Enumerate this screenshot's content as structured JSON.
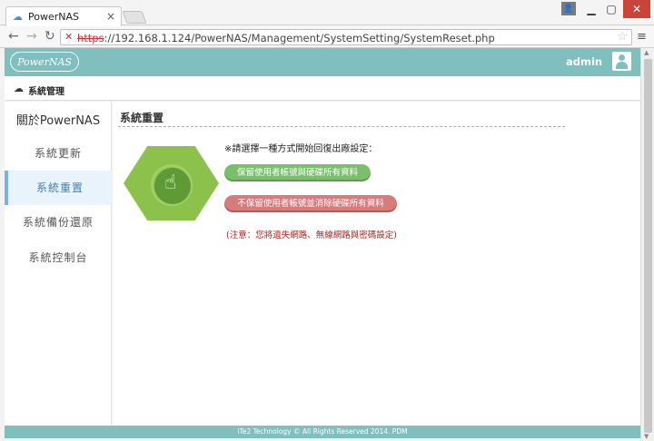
{
  "browser": {
    "tab_title": "PowerNAS",
    "tab_close": "×",
    "url_scheme": "https",
    "url_rest": "://192.168.1.124/PowerNAS/Management/SystemSetting/SystemReset.php"
  },
  "header": {
    "logo_text": "PowerNAS",
    "username": "admin"
  },
  "breadcrumb": {
    "label": "系統管理"
  },
  "sidebar": {
    "title": "關於PowerNAS",
    "items": [
      {
        "label": "系統更新",
        "active": false
      },
      {
        "label": "系統重置",
        "active": true
      },
      {
        "label": "系統備份還原",
        "active": false
      },
      {
        "label": "系統控制台",
        "active": false
      }
    ]
  },
  "main": {
    "title": "系統重置",
    "instruction": "※請選擇一種方式開始回復出廠設定：",
    "keep_button": "保留使用者帳號與硬碟所有資料",
    "erase_button": "不保留使用者帳號並消除硬碟所有資料",
    "warning": "(注意：您將遺失網路、無線網路與密碼設定)"
  },
  "footer": {
    "text": "iTe2 Technology © All Rights Reserved 2014. PDM"
  },
  "colors": {
    "header_bg": "#7fbfbd",
    "keep_button": "#7bbf6d",
    "erase_button": "#d87b7b",
    "warning_text": "#b3241f",
    "icon_hex": "#8cc14b"
  }
}
